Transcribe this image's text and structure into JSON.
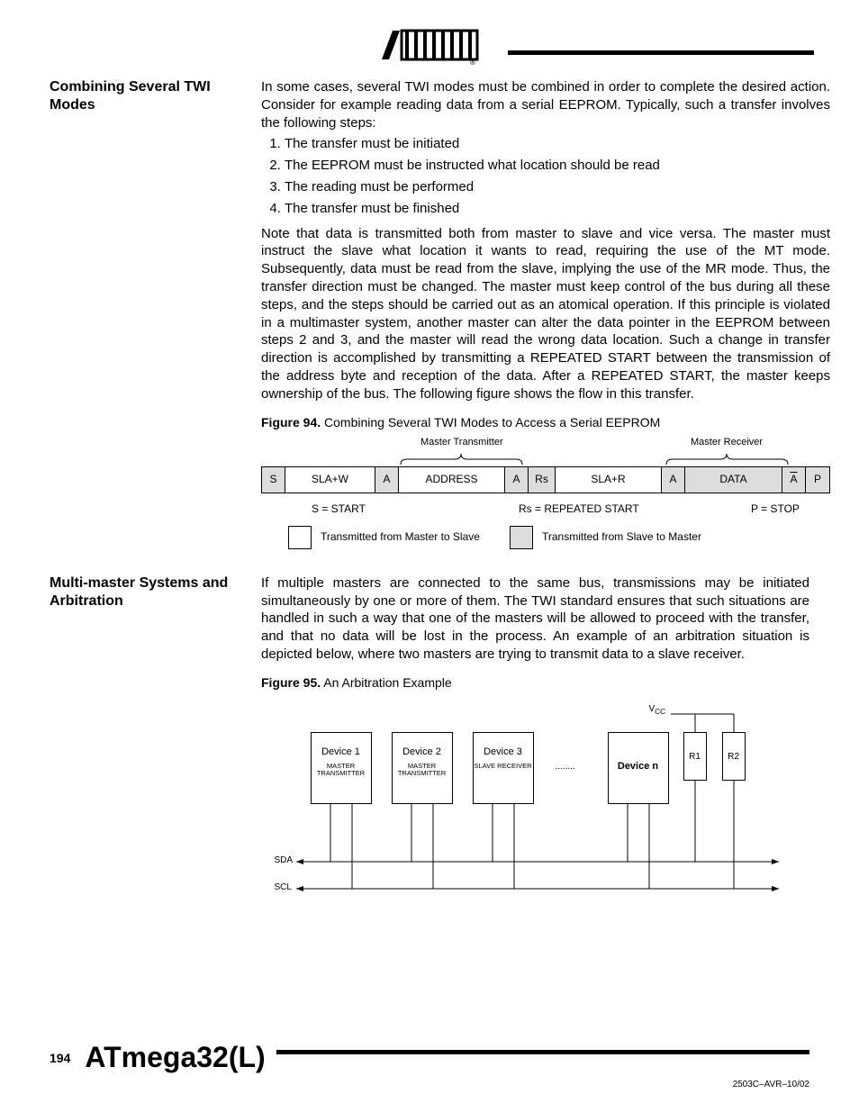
{
  "header": {
    "brand": "ATMEL"
  },
  "section1": {
    "heading": "Combining Several TWI Modes",
    "intro": "In some cases, several TWI modes must be combined in order to complete the desired action. Consider for example reading data from a serial EEPROM. Typically, such a transfer involves the following steps:",
    "steps": [
      "The transfer must be initiated",
      "The EEPROM must be instructed what location should be read",
      "The reading must be performed",
      "The transfer must be finished"
    ],
    "note": "Note that data is transmitted both from master to slave and vice versa. The master must instruct the slave what location it wants to read, requiring the use of the MT mode. Subsequently, data must be read from the slave, implying the use of the MR mode. Thus, the transfer direction must be changed. The master must keep control of the bus during all these steps, and the steps should be carried out as an atomical operation. If this principle is violated in a multimaster system, another master can alter the data pointer in the EEPROM between steps 2 and 3, and the master will read the wrong data location. Such a change in transfer direction is accomplished by transmitting a REPEATED START between the transmission of the address byte and reception of the data. After a REPEATED START, the master keeps ownership of the bus. The following figure shows the flow in this transfer."
  },
  "figure94": {
    "label": "Figure 94.",
    "caption": "Combining Several TWI Modes to Access a Serial EEPROM",
    "master_transmitter": "Master Transmitter",
    "master_receiver": "Master Receiver",
    "cells": {
      "s": "S",
      "slaw": "SLA+W",
      "a": "A",
      "address": "ADDRESS",
      "rs": "Rs",
      "slar": "SLA+R",
      "data": "DATA",
      "p": "P"
    },
    "legend": {
      "s_start": "S = START",
      "rs_repeated": "Rs = REPEATED START",
      "p_stop": "P = STOP",
      "m2s": "Transmitted from Master to Slave",
      "s2m": "Transmitted from Slave to Master"
    }
  },
  "section2": {
    "heading": "Multi-master Systems and Arbitration",
    "body": "If multiple masters are connected to the same bus, transmissions may be initiated simultaneously by one or more of them. The TWI standard ensures that such situations are handled in such a way that one of the masters will be allowed to proceed with the transfer, and that no data will be lost in the process. An example of an arbitration situation is depicted below, where two masters are trying to transmit data to a slave receiver."
  },
  "figure95": {
    "label": "Figure 95.",
    "caption": "An Arbitration Example",
    "vcc": "VCC",
    "dev1": "Device 1",
    "dev1_role": "MASTER TRANSMITTER",
    "dev2": "Device 2",
    "dev2_role": "MASTER TRANSMITTER",
    "dev3": "Device 3",
    "dev3_role": "SLAVE RECEIVER",
    "dots": "........",
    "devn": "Device n",
    "r1": "R1",
    "r2": "R2",
    "sda": "SDA",
    "scl": "SCL"
  },
  "footer": {
    "page": "194",
    "chip": "ATmega32(L)",
    "docid": "2503C–AVR–10/02"
  }
}
